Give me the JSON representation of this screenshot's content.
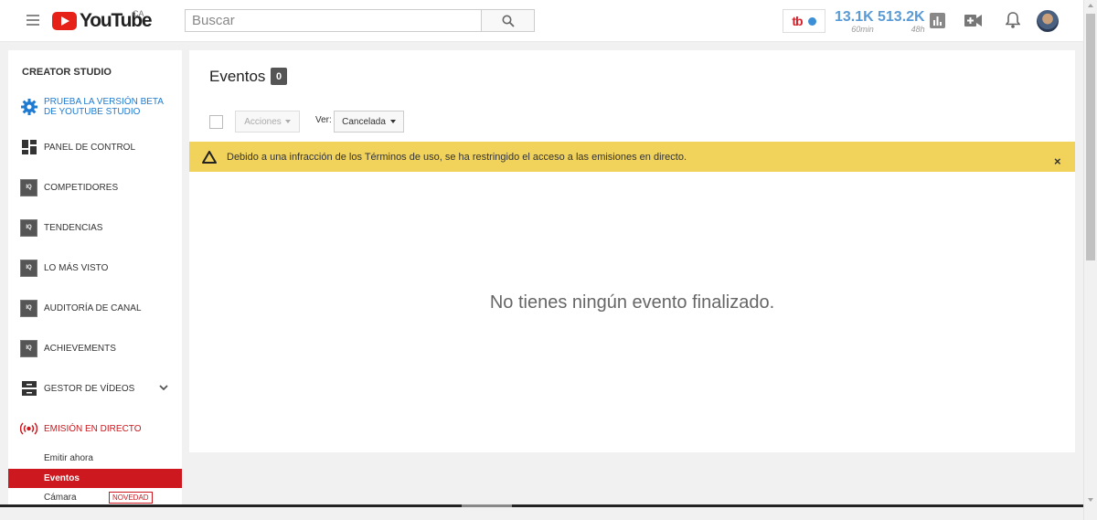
{
  "header": {
    "logo_text": "YouTube",
    "country": "CA",
    "search_placeholder": "Buscar",
    "tb_logo": "tb",
    "stats": [
      {
        "value": "13.1K",
        "sub": "60min"
      },
      {
        "value": "513.2K",
        "sub": "48h"
      }
    ]
  },
  "sidebar": {
    "title": "CREATOR STUDIO",
    "beta_label": "PRUEBA LA VERSIÓN BETA DE YOUTUBE STUDIO",
    "items": [
      {
        "label": "PANEL DE CONTROL"
      },
      {
        "label": "COMPETIDORES"
      },
      {
        "label": "TENDENCIAS"
      },
      {
        "label": "LO MÁS VISTO"
      },
      {
        "label": "AUDITORÍA DE CANAL"
      },
      {
        "label": "ACHIEVEMENTS"
      },
      {
        "label": "GESTOR DE VÍDEOS"
      },
      {
        "label": "EMISIÓN EN DIRECTO"
      }
    ],
    "sub_items": [
      {
        "label": "Emitir ahora"
      },
      {
        "label": "Eventos"
      },
      {
        "label": "Cámara"
      }
    ],
    "new_badge": "NOVEDAD",
    "iq_text": "IQ"
  },
  "main": {
    "title": "Eventos",
    "count": "0",
    "actions_label": "Acciones",
    "ver_label": "Ver:",
    "filter_value": "Cancelada",
    "warning_text": "Debido a una infracción de los Términos de uso, se ha restringido el acceso a las emisiones en directo.",
    "close_glyph": "×",
    "empty_message": "No tienes ningún evento finalizado."
  },
  "colors": {
    "brand_red": "#cc181e",
    "warning_bg": "#f1d35c",
    "link_blue": "#1e7bd1"
  }
}
